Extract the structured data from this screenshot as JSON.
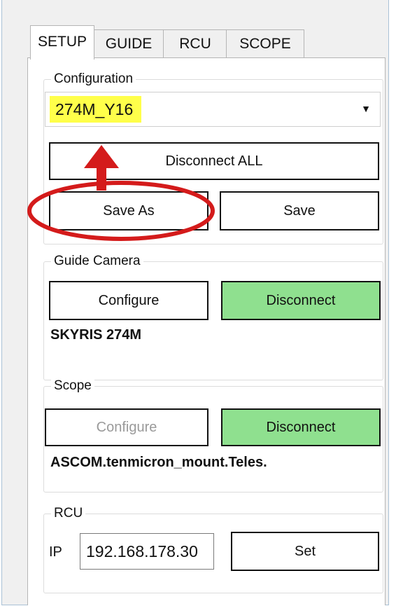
{
  "tabs": [
    {
      "label": "SETUP",
      "active": true
    },
    {
      "label": "GUIDE",
      "active": false
    },
    {
      "label": "RCU",
      "active": false
    },
    {
      "label": "SCOPE",
      "active": false
    }
  ],
  "configuration": {
    "title": "Configuration",
    "selected": "274M_Y16",
    "disconnect_all_label": "Disconnect ALL",
    "save_as_label": "Save As",
    "save_label": "Save"
  },
  "guide_camera": {
    "title": "Guide Camera",
    "configure_label": "Configure",
    "disconnect_label": "Disconnect",
    "device_name": "SKYRIS 274M"
  },
  "scope": {
    "title": "Scope",
    "configure_label": "Configure",
    "disconnect_label": "Disconnect",
    "device_name": "ASCOM.tenmicron_mount.Teles."
  },
  "rcu": {
    "title": "RCU",
    "ip_label": "IP",
    "ip_value": "192.168.178.30",
    "set_label": "Set"
  },
  "colors": {
    "highlight": "#ffff4a",
    "connected_green": "#8fe08f",
    "annotation_red": "#d41b1b"
  }
}
